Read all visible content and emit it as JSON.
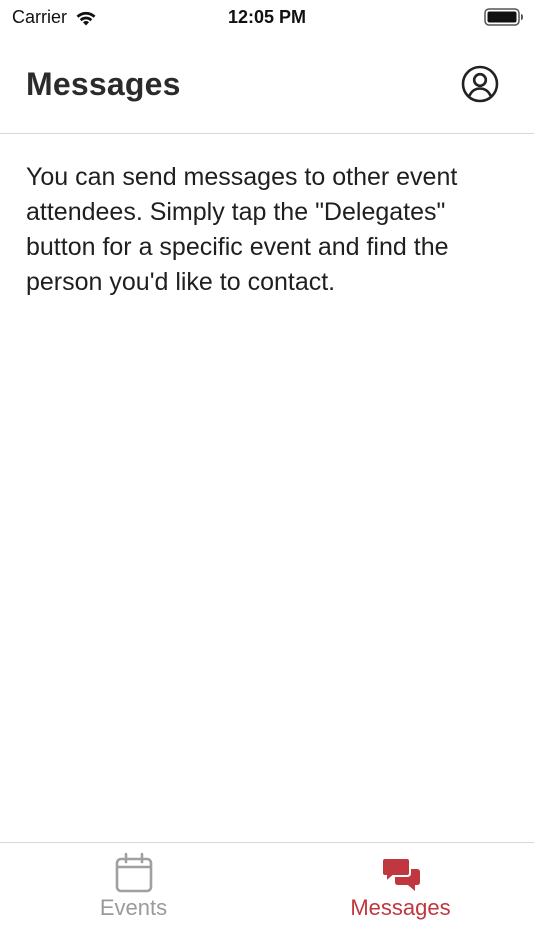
{
  "status_bar": {
    "carrier": "Carrier",
    "time": "12:05 PM",
    "icons": [
      "wifi-icon",
      "battery-icon"
    ]
  },
  "header": {
    "title": "Messages",
    "profile_icon": "user-circle-icon"
  },
  "main": {
    "info_text": "You can send messages to other event attendees. Simply tap the \"Delegates\" button for a specific event and find the person you'd like to contact."
  },
  "tab_bar": {
    "tabs": [
      {
        "label": "Events",
        "icon": "calendar-icon",
        "active": false
      },
      {
        "label": "Messages",
        "icon": "chat-bubbles-icon",
        "active": true
      }
    ]
  },
  "colors": {
    "accent": "#c0373f",
    "inactive": "#9a9a9a",
    "title": "#2b2b2b",
    "divider": "#d9d9d9"
  }
}
